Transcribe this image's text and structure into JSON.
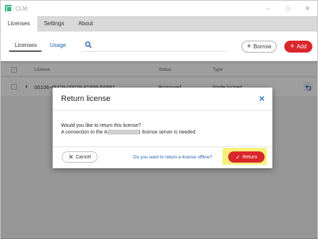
{
  "window": {
    "title": "CLM",
    "controls": {
      "minimize": "–",
      "maximize": "□",
      "close": "✕"
    }
  },
  "menu": {
    "tabs": [
      {
        "label": "Licenses",
        "active": true
      },
      {
        "label": "Settings",
        "active": false
      },
      {
        "label": "About",
        "active": false
      }
    ]
  },
  "toolbar": {
    "subtabs": {
      "licenses": "Licenses",
      "usage": "Usage"
    },
    "borrow_label": "Borrow",
    "add_label": "Add",
    "plus_glyph": "+",
    "search_icon": "search-icon"
  },
  "table": {
    "headers": {
      "license": "License",
      "status": "Status",
      "type": "Type"
    },
    "rows": [
      {
        "license": "00106-48429-00029-91898-F6887",
        "status": "Borrowed",
        "type": "Node locked"
      }
    ]
  },
  "dialog": {
    "title": "Return license",
    "close_glyph": "✕",
    "message_line1": "Would you like to return this license?",
    "message_line2_prefix": "A connection to the A",
    "message_line2_suffix": "1 license server is needed.",
    "cancel_label": "Cancel",
    "cancel_glyph": "✕",
    "offline_link": "Do you want to return a license offline?",
    "return_label": "Return",
    "return_glyph": "✓"
  },
  "colors": {
    "accent": "#d9262c",
    "link": "#1e5fa8",
    "highlight": "#f6f07a"
  }
}
